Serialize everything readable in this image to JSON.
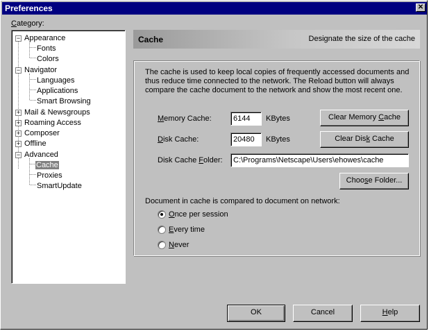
{
  "window": {
    "title": "Preferences",
    "close_glyph": "✕"
  },
  "category_label_pre": "",
  "category_label_ul": "C",
  "category_label_post": "ategory:",
  "tree": {
    "appearance": "Appearance",
    "fonts": "Fonts",
    "colors": "Colors",
    "navigator": "Navigator",
    "languages": "Languages",
    "applications": "Applications",
    "smart_browsing": "Smart Browsing",
    "mail": "Mail & Newsgroups",
    "roaming": "Roaming Access",
    "composer": "Composer",
    "offline": "Offline",
    "advanced": "Advanced",
    "cache": "Cache",
    "proxies": "Proxies",
    "smartupdate": "SmartUpdate",
    "expanded_glyph": "−",
    "collapsed_glyph": "+"
  },
  "panel": {
    "title": "Cache",
    "subtitle": "Designate the size of the cache",
    "description": "The cache is used to keep local copies of frequently accessed documents and thus reduce time connected to the network. The Reload button will always compare the cache document to the network and show the most recent one."
  },
  "memory": {
    "label_pre": "",
    "label_ul": "M",
    "label_post": "emory Cache:",
    "value": "6144",
    "unit": "KBytes"
  },
  "disk": {
    "label_pre": "",
    "label_ul": "D",
    "label_post": "isk Cache:",
    "value": "20480",
    "unit": "KBytes"
  },
  "folder": {
    "label_pre": "Disk Cache ",
    "label_ul": "F",
    "label_post": "older:",
    "value": "C:\\Programs\\Netscape\\Users\\ehowes\\cache"
  },
  "buttons": {
    "clear_memory_pre": "Clear Memory ",
    "clear_memory_ul": "C",
    "clear_memory_post": "ache",
    "clear_disk_pre": "Clear Dis",
    "clear_disk_ul": "k",
    "clear_disk_post": " Cache",
    "choose_pre": "Choo",
    "choose_ul": "s",
    "choose_post": "e Folder..."
  },
  "compare": {
    "question": "Document in cache is compared to document on network:",
    "options": [
      {
        "ul": "O",
        "rest": "nce per session"
      },
      {
        "ul": "E",
        "rest": "very time"
      },
      {
        "ul": "N",
        "rest": "ever"
      }
    ],
    "selected": "Once per session"
  },
  "dialog": {
    "ok": "OK",
    "cancel": "Cancel",
    "help_ul": "H",
    "help_rest": "elp"
  }
}
